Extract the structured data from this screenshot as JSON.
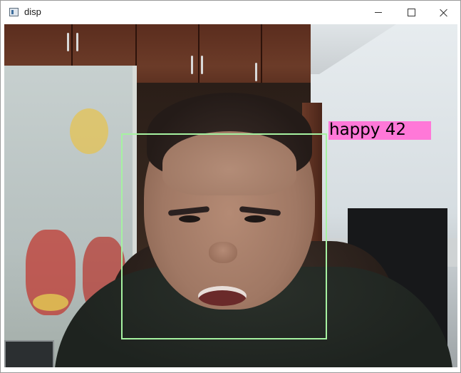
{
  "window": {
    "title": "disp",
    "controls": {
      "minimize": "minimize",
      "maximize": "maximize",
      "close": "close"
    }
  },
  "detection": {
    "label": "happy 42",
    "box_color": "#a6f2a1",
    "label_bg_color": "#ff78d8"
  }
}
